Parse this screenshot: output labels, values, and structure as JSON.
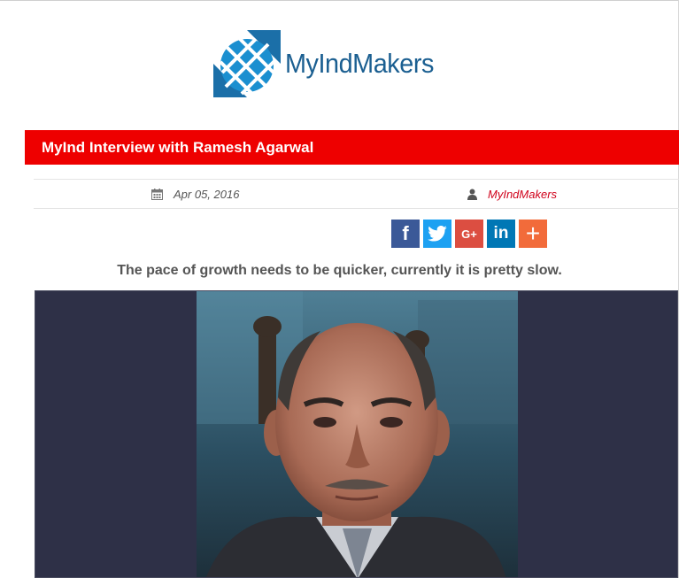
{
  "logo": {
    "text": "MyIndMakers"
  },
  "article": {
    "title": "MyInd Interview with Ramesh Agarwal",
    "date": "Apr 05, 2016",
    "author": "MyIndMakers",
    "subtitle": "The pace of growth needs to be quicker, currently it is pretty slow."
  },
  "share": [
    {
      "name": "facebook",
      "glyph": "f"
    },
    {
      "name": "twitter",
      "glyph": ""
    },
    {
      "name": "google-plus",
      "glyph": "G+"
    },
    {
      "name": "linkedin",
      "glyph": "in"
    },
    {
      "name": "more",
      "glyph": "+"
    }
  ],
  "colors": {
    "title_bar": "#ee0000",
    "author_link": "#d0021b",
    "logo_text": "#1b5f91",
    "photo_background": "#2e3047"
  }
}
